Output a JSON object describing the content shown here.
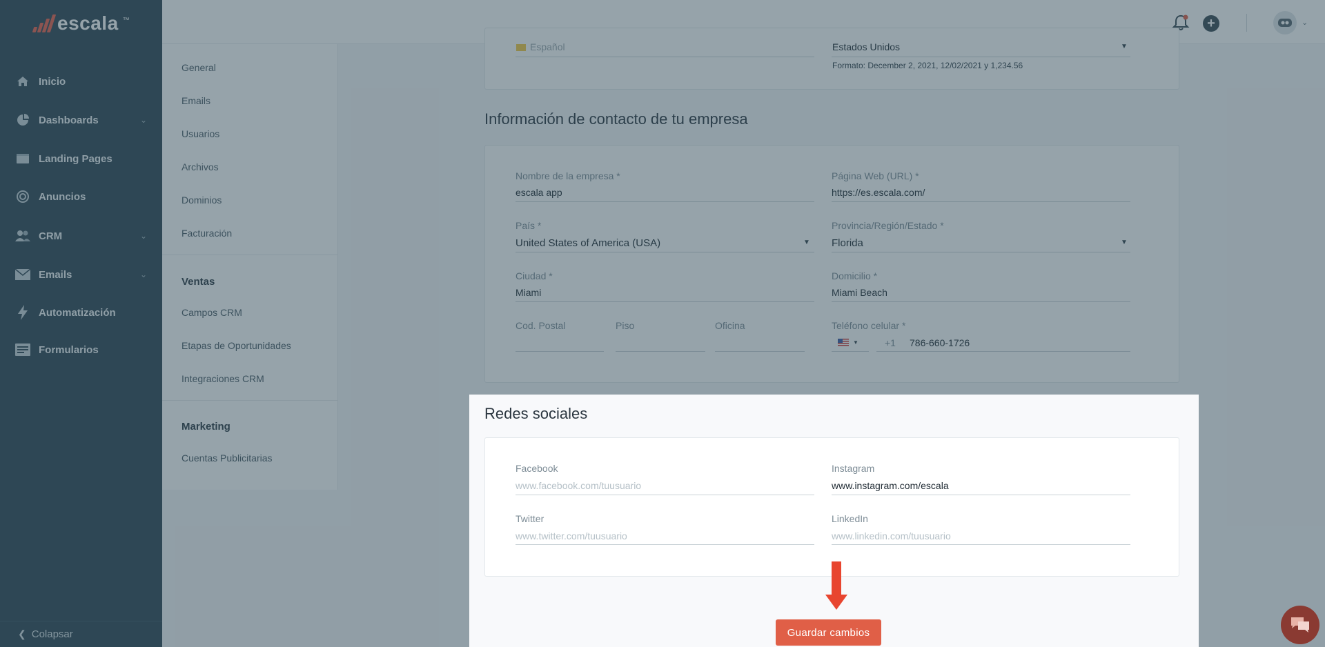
{
  "brand": {
    "name": "escala",
    "trademark": "™"
  },
  "sidebar": {
    "items": [
      {
        "label": "Inicio",
        "icon": "home-icon",
        "has_submenu": false
      },
      {
        "label": "Dashboards",
        "icon": "pie-chart-icon",
        "has_submenu": true
      },
      {
        "label": "Landing Pages",
        "icon": "browser-window-icon",
        "has_submenu": false
      },
      {
        "label": "Anuncios",
        "icon": "target-icon",
        "has_submenu": false
      },
      {
        "label": "CRM",
        "icon": "users-icon",
        "has_submenu": true
      },
      {
        "label": "Emails",
        "icon": "envelope-icon",
        "has_submenu": true
      },
      {
        "label": "Automatización",
        "icon": "lightning-icon",
        "has_submenu": false
      },
      {
        "label": "Formularios",
        "icon": "form-icon",
        "has_submenu": false
      }
    ],
    "collapse_label": "Colapsar"
  },
  "subnav": {
    "general": [
      "General",
      "Emails",
      "Usuarios",
      "Archivos",
      "Dominios",
      "Facturación"
    ],
    "active": "General",
    "ventas_heading": "Ventas",
    "ventas": [
      "Campos CRM",
      "Etapas de Oportunidades",
      "Integraciones CRM"
    ],
    "marketing_heading": "Marketing",
    "marketing": [
      "Cuentas Publicitarias"
    ]
  },
  "regional": {
    "language_value": "Español",
    "country_value": "Estados Unidos",
    "format_note": "Formato: December 2, 2021, 12/02/2021 y 1,234.56"
  },
  "contact": {
    "title": "Información de contacto de tu empresa",
    "company_label": "Nombre de la empresa *",
    "company_value": "escala app",
    "web_label": "Página Web (URL) *",
    "web_value": "https://es.escala.com/",
    "country_label": "País *",
    "country_value": "United States of America (USA)",
    "state_label": "Provincia/Región/Estado *",
    "state_value": "Florida",
    "city_label": "Ciudad *",
    "city_value": "Miami",
    "address_label": "Domicilio *",
    "address_value": "Miami Beach",
    "postal_label": "Cod. Postal",
    "floor_label": "Piso",
    "office_label": "Oficina",
    "phone_label": "Teléfono celular *",
    "phone_prefix": "+1",
    "phone_value": "786-660-1726"
  },
  "social": {
    "title": "Redes sociales",
    "facebook_label": "Facebook",
    "facebook_placeholder": "www.facebook.com/tuusuario",
    "instagram_label": "Instagram",
    "instagram_value": "www.instagram.com/escala",
    "twitter_label": "Twitter",
    "twitter_placeholder": "www.twitter.com/tuusuario",
    "linkedin_label": "LinkedIn",
    "linkedin_placeholder": "www.linkedin.com/tuusuario"
  },
  "actions": {
    "save_label": "Guardar cambios"
  },
  "colors": {
    "sidebar": "#2e4755",
    "accent": "#e05f47",
    "arrow": "#e8452f"
  }
}
